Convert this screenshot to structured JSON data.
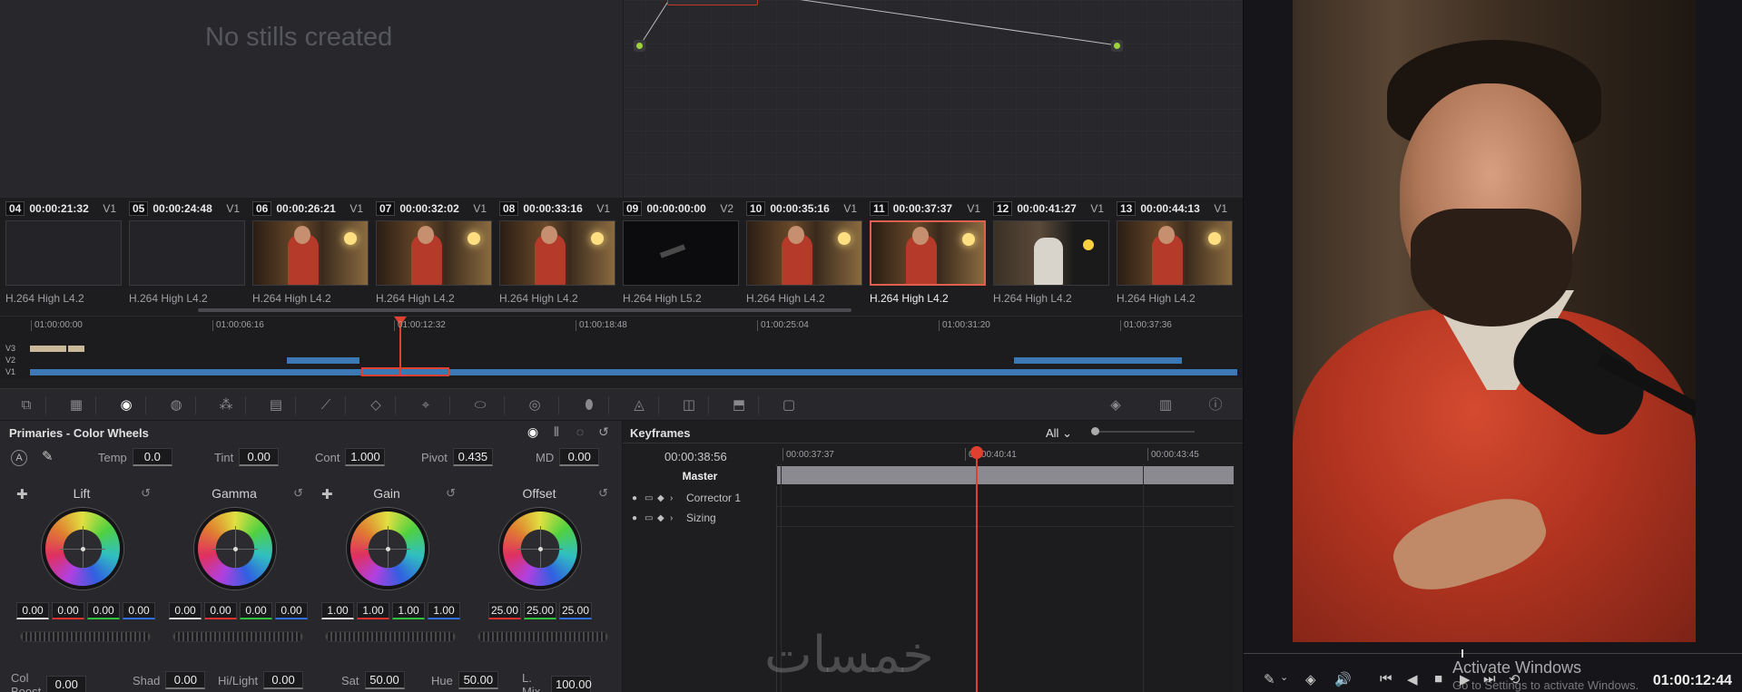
{
  "gallery": {
    "empty_text": "No stills created"
  },
  "clips": [
    {
      "num": "04",
      "tc": "00:00:21:32",
      "track": "V1",
      "codec": "H.264 High L4.2",
      "thumb": "empty",
      "selected": false
    },
    {
      "num": "05",
      "tc": "00:00:24:48",
      "track": "V1",
      "codec": "H.264 High L4.2",
      "thumb": "empty",
      "selected": false
    },
    {
      "num": "06",
      "tc": "00:00:26:21",
      "track": "V1",
      "codec": "H.264 High L4.2",
      "thumb": "room",
      "selected": false
    },
    {
      "num": "07",
      "tc": "00:00:32:02",
      "track": "V1",
      "codec": "H.264 High L4.2",
      "thumb": "room",
      "selected": false
    },
    {
      "num": "08",
      "tc": "00:00:33:16",
      "track": "V1",
      "codec": "H.264 High L4.2",
      "thumb": "room",
      "selected": false
    },
    {
      "num": "09",
      "tc": "00:00:00:00",
      "track": "V2",
      "codec": "H.264 High L5.2",
      "thumb": "dark",
      "selected": false
    },
    {
      "num": "10",
      "tc": "00:00:35:16",
      "track": "V1",
      "codec": "H.264 High L4.2",
      "thumb": "room",
      "selected": false
    },
    {
      "num": "11",
      "tc": "00:00:37:37",
      "track": "V1",
      "codec": "H.264 High L4.2",
      "thumb": "room",
      "selected": true
    },
    {
      "num": "12",
      "tc": "00:00:41:27",
      "track": "V1",
      "codec": "H.264 High L4.2",
      "thumb": "white",
      "selected": false
    },
    {
      "num": "13",
      "tc": "00:00:44:13",
      "track": "V1",
      "codec": "H.264 High L4.2",
      "thumb": "room",
      "selected": false
    }
  ],
  "mini_timeline": {
    "ticks": [
      "01:00:00:00",
      "01:00:06:16",
      "01:00:12:32",
      "01:00:18:48",
      "01:00:25:04",
      "01:00:31:20",
      "01:00:37:36"
    ],
    "tracks": [
      "V3",
      "V2",
      "V1"
    ]
  },
  "toolbar": {
    "icons": [
      "camera-raw-icon",
      "color-match-icon",
      "color-wheels-icon",
      "hdr-icon",
      "rgb-mixer-icon",
      "motion-effects-icon",
      "curves-icon",
      "color-warper-icon",
      "qualifier-icon",
      "window-icon",
      "tracker-icon",
      "magic-mask-icon",
      "blur-icon",
      "key-icon",
      "sizing-icon",
      "3d-icon",
      "keyframes-icon",
      "scopes-icon",
      "info-icon"
    ]
  },
  "primaries": {
    "title": "Primaries - Color Wheels",
    "auto_label": "A",
    "params_top": [
      {
        "label": "Temp",
        "value": "0.0"
      },
      {
        "label": "Tint",
        "value": "0.00"
      },
      {
        "label": "Cont",
        "value": "1.000"
      },
      {
        "label": "Pivot",
        "value": "0.435"
      },
      {
        "label": "MD",
        "value": "0.00"
      }
    ],
    "wheels": [
      {
        "name": "Lift",
        "values": [
          "0.00",
          "0.00",
          "0.00",
          "0.00"
        ]
      },
      {
        "name": "Gamma",
        "values": [
          "0.00",
          "0.00",
          "0.00",
          "0.00"
        ]
      },
      {
        "name": "Gain",
        "values": [
          "1.00",
          "1.00",
          "1.00",
          "1.00"
        ]
      },
      {
        "name": "Offset",
        "values": [
          "25.00",
          "25.00",
          "25.00"
        ]
      }
    ],
    "params_bottom": [
      {
        "label": "Col Boost",
        "value": "0.00"
      },
      {
        "label": "Shad",
        "value": "0.00"
      },
      {
        "label": "Hi/Light",
        "value": "0.00"
      },
      {
        "label": "Sat",
        "value": "50.00"
      },
      {
        "label": "Hue",
        "value": "50.00"
      },
      {
        "label": "L. Mix",
        "value": "100.00"
      }
    ]
  },
  "keyframes": {
    "title": "Keyframes",
    "filter": "All",
    "timecode": "00:00:38:56",
    "ticks": [
      "00:00:37:37",
      "00:00:40:41",
      "00:00:43:45"
    ],
    "rows": [
      "Master",
      "Corrector 1",
      "Sizing"
    ]
  },
  "watermark": "خمسات",
  "viewer": {
    "timecode": "01:00:12:44",
    "activate_title": "Activate Windows",
    "activate_sub": "Go to Settings to activate Windows."
  }
}
